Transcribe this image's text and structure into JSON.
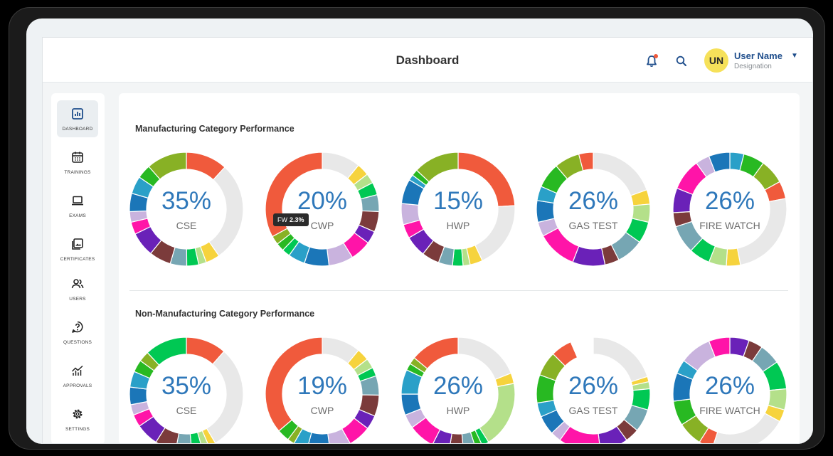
{
  "header": {
    "title": "Dashboard",
    "user_initials": "UN",
    "user_name": "User Name",
    "user_role": "Designation"
  },
  "icons": {
    "notification": "bell-icon",
    "search": "search-icon",
    "caret": "chevron-down-icon"
  },
  "sidebar": {
    "items": [
      {
        "label": "DASHBOARD",
        "icon": "bar-chart-icon",
        "active": true
      },
      {
        "label": "TRAININGS",
        "icon": "calendar-icon",
        "active": false
      },
      {
        "label": "EXAMS",
        "icon": "laptop-icon",
        "active": false
      },
      {
        "label": "CERTIFICATES",
        "icon": "image-gallery-icon",
        "active": false
      },
      {
        "label": "USERS",
        "icon": "users-icon",
        "active": false
      },
      {
        "label": "QUESTIONS",
        "icon": "question-icon",
        "active": false
      },
      {
        "label": "APPROVALS",
        "icon": "trend-chart-icon",
        "active": false
      },
      {
        "label": "SETTINGS",
        "icon": "gear-icon",
        "active": false
      }
    ]
  },
  "colors": {
    "accent_text": "#2f78ba",
    "main_segment": "#f05a3c",
    "remainder": "#e8e8e8",
    "notification_dot": "#f05a3c",
    "avatar": "#f6e15a",
    "palette": [
      "#f6d33d",
      "#b4e08a",
      "#00c853",
      "#76a6b3",
      "#7b3b3b",
      "#6a21b8",
      "#ff14a8",
      "#c9b3de",
      "#1b76b8",
      "#2aa0c8",
      "#28b922",
      "#88b125",
      "#f05a3c",
      "#ffffff"
    ]
  },
  "sections": [
    {
      "title": "Manufacturing Category Performance",
      "charts": [
        {
          "value": "35%",
          "label": "CSE"
        },
        {
          "value": "20%",
          "label": "CWP"
        },
        {
          "value": "15%",
          "label": "HWP"
        },
        {
          "value": "26%",
          "label": "GAS TEST"
        },
        {
          "value": "26%",
          "label": "FIRE WATCH"
        }
      ]
    },
    {
      "title": "Non-Manufacturing Category Performance",
      "charts": [
        {
          "value": "35%",
          "label": "CSE"
        },
        {
          "value": "19%",
          "label": "CWP"
        },
        {
          "value": "26%",
          "label": "HWP"
        },
        {
          "value": "26%",
          "label": "GAS TEST"
        },
        {
          "value": "26%",
          "label": "FIRE WATCH"
        }
      ]
    }
  ],
  "tooltip": {
    "label": "FW",
    "value": "2.3%"
  },
  "chart_data": [
    {
      "type": "pie",
      "title": "CSE",
      "segments": [
        [
          "#f05a3c",
          0.118
        ],
        [
          "#e8e8e8",
          0.285
        ],
        [
          "#f6d33d",
          0.04
        ],
        [
          "#b4e08a",
          0.022
        ],
        [
          "#00c853",
          0.034
        ],
        [
          "#76a6b3",
          0.047
        ],
        [
          "#7b3b3b",
          0.062
        ],
        [
          "#6a21b8",
          0.07
        ],
        [
          "#ff14a8",
          0.035
        ],
        [
          "#c9b3de",
          0.03
        ],
        [
          "#1b76b8",
          0.052
        ],
        [
          "#2aa0c8",
          0.05
        ],
        [
          "#28b922",
          0.04
        ],
        [
          "#88b125",
          0.115
        ]
      ]
    },
    {
      "type": "pie",
      "title": "CWP",
      "segments": [
        [
          "#e8e8e8",
          0.11
        ],
        [
          "#f6d33d",
          0.035
        ],
        [
          "#b4e08a",
          0.028
        ],
        [
          "#00c853",
          0.036
        ],
        [
          "#76a6b3",
          0.048
        ],
        [
          "#7b3b3b",
          0.058
        ],
        [
          "#6a21b8",
          0.036
        ],
        [
          "#ff14a8",
          0.06
        ],
        [
          "#c9b3de",
          0.07
        ],
        [
          "#1b76b8",
          0.07
        ],
        [
          "#2aa0c8",
          0.048
        ],
        [
          "#00c853",
          0.023
        ],
        [
          "#28b922",
          0.023
        ],
        [
          "#88b125",
          0.025
        ],
        [
          "#f05a3c",
          0.33
        ]
      ]
    },
    {
      "type": "pie",
      "title": "HWP",
      "segments": [
        [
          "#f05a3c",
          0.24
        ],
        [
          "#e8e8e8",
          0.19
        ],
        [
          "#f6d33d",
          0.036
        ],
        [
          "#b4e08a",
          0.02
        ],
        [
          "#00c853",
          0.03
        ],
        [
          "#76a6b3",
          0.04
        ],
        [
          "#7b3b3b",
          0.05
        ],
        [
          "#6a21b8",
          0.06
        ],
        [
          "#ff14a8",
          0.04
        ],
        [
          "#c9b3de",
          0.06
        ],
        [
          "#1b76b8",
          0.07
        ],
        [
          "#2aa0c8",
          0.016
        ],
        [
          "#28b922",
          0.018
        ],
        [
          "#88b125",
          0.13
        ]
      ]
    },
    {
      "type": "pie",
      "title": "GAS TEST",
      "segments": [
        [
          "#e8e8e8",
          0.19
        ],
        [
          "#f6d33d",
          0.04
        ],
        [
          "#b4e08a",
          0.05
        ],
        [
          "#00c853",
          0.06
        ],
        [
          "#76a6b3",
          0.075
        ],
        [
          "#7b3b3b",
          0.04
        ],
        [
          "#6a21b8",
          0.09
        ],
        [
          "#ff14a8",
          0.11
        ],
        [
          "#c9b3de",
          0.04
        ],
        [
          "#1b76b8",
          0.06
        ],
        [
          "#2aa0c8",
          0.04
        ],
        [
          "#28b922",
          0.07
        ],
        [
          "#88b125",
          0.07
        ],
        [
          "#f05a3c",
          0.04
        ]
      ]
    },
    {
      "type": "pie",
      "title": "FIRE WATCH",
      "segments": [
        [
          "#2aa0c8",
          0.04
        ],
        [
          "#28b922",
          0.06
        ],
        [
          "#88b125",
          0.07
        ],
        [
          "#f05a3c",
          0.05
        ],
        [
          "#e8e8e8",
          0.25
        ],
        [
          "#f6d33d",
          0.04
        ],
        [
          "#b4e08a",
          0.05
        ],
        [
          "#00c853",
          0.06
        ],
        [
          "#76a6b3",
          0.08
        ],
        [
          "#7b3b3b",
          0.04
        ],
        [
          "#6a21b8",
          0.07
        ],
        [
          "#ff14a8",
          0.09
        ],
        [
          "#c9b3de",
          0.04
        ],
        [
          "#1b76b8",
          0.06
        ]
      ]
    },
    {
      "type": "pie",
      "title": "CSE",
      "segments": [
        [
          "#f05a3c",
          0.115
        ],
        [
          "#e8e8e8",
          0.3
        ],
        [
          "#f6d33d",
          0.02
        ],
        [
          "#b4e08a",
          0.02
        ],
        [
          "#00c853",
          0.03
        ],
        [
          "#76a6b3",
          0.045
        ],
        [
          "#7b3b3b",
          0.06
        ],
        [
          "#6a21b8",
          0.065
        ],
        [
          "#ff14a8",
          0.035
        ],
        [
          "#c9b3de",
          0.03
        ],
        [
          "#1b76b8",
          0.05
        ],
        [
          "#2aa0c8",
          0.045
        ],
        [
          "#28b922",
          0.035
        ],
        [
          "#88b125",
          0.03
        ],
        [
          "#00c853",
          0.12
        ]
      ]
    },
    {
      "type": "pie",
      "title": "CWP",
      "segments": [
        [
          "#e8e8e8",
          0.11
        ],
        [
          "#f6d33d",
          0.035
        ],
        [
          "#b4e08a",
          0.028
        ],
        [
          "#00c853",
          0.025
        ],
        [
          "#76a6b3",
          0.055
        ],
        [
          "#7b3b3b",
          0.06
        ],
        [
          "#6a21b8",
          0.04
        ],
        [
          "#ff14a8",
          0.065
        ],
        [
          "#c9b3de",
          0.06
        ],
        [
          "#1b76b8",
          0.065
        ],
        [
          "#2aa0c8",
          0.04
        ],
        [
          "#88b125",
          0.02
        ],
        [
          "#28b922",
          0.035
        ],
        [
          "#f05a3c",
          0.362
        ]
      ]
    },
    {
      "type": "pie",
      "title": "HWP",
      "segments": [
        [
          "#e8e8e8",
          0.19
        ],
        [
          "#f6d33d",
          0.03
        ],
        [
          "#b4e08a",
          0.19
        ],
        [
          "#00c853",
          0.02
        ],
        [
          "#28b922",
          0.02
        ],
        [
          "#76a6b3",
          0.035
        ],
        [
          "#7b3b3b",
          0.04
        ],
        [
          "#6a21b8",
          0.05
        ],
        [
          "#ff14a8",
          0.075
        ],
        [
          "#c9b3de",
          0.04
        ],
        [
          "#1b76b8",
          0.06
        ],
        [
          "#2aa0c8",
          0.07
        ],
        [
          "#28b922",
          0.02
        ],
        [
          "#88b125",
          0.02
        ],
        [
          "#f05a3c",
          0.14
        ]
      ]
    },
    {
      "type": "pie",
      "title": "GAS TEST",
      "segments": [
        [
          "#e8e8e8",
          0.2
        ],
        [
          "#f6d33d",
          0.015
        ],
        [
          "#b4e08a",
          0.02
        ],
        [
          "#00c853",
          0.06
        ],
        [
          "#76a6b3",
          0.065
        ],
        [
          "#7b3b3b",
          0.04
        ],
        [
          "#6a21b8",
          0.08
        ],
        [
          "#ff14a8",
          0.12
        ],
        [
          "#c9b3de",
          0.03
        ],
        [
          "#1b76b8",
          0.055
        ],
        [
          "#2aa0c8",
          0.04
        ],
        [
          "#28b922",
          0.08
        ],
        [
          "#88b125",
          0.07
        ],
        [
          "#f05a3c",
          0.06
        ],
        [
          "#ffffff",
          0.065
        ]
      ]
    },
    {
      "type": "pie",
      "title": "FIRE WATCH",
      "segments": [
        [
          "#6a21b8",
          0.055
        ],
        [
          "#7b3b3b",
          0.04
        ],
        [
          "#76a6b3",
          0.06
        ],
        [
          "#00c853",
          0.08
        ],
        [
          "#b4e08a",
          0.06
        ],
        [
          "#f6d33d",
          0.035
        ],
        [
          "#e8e8e8",
          0.22
        ],
        [
          "#f05a3c",
          0.04
        ],
        [
          "#88b125",
          0.07
        ],
        [
          "#28b922",
          0.07
        ],
        [
          "#1b76b8",
          0.08
        ],
        [
          "#2aa0c8",
          0.04
        ],
        [
          "#c9b3de",
          0.09
        ],
        [
          "#ff14a8",
          0.06
        ]
      ]
    }
  ]
}
